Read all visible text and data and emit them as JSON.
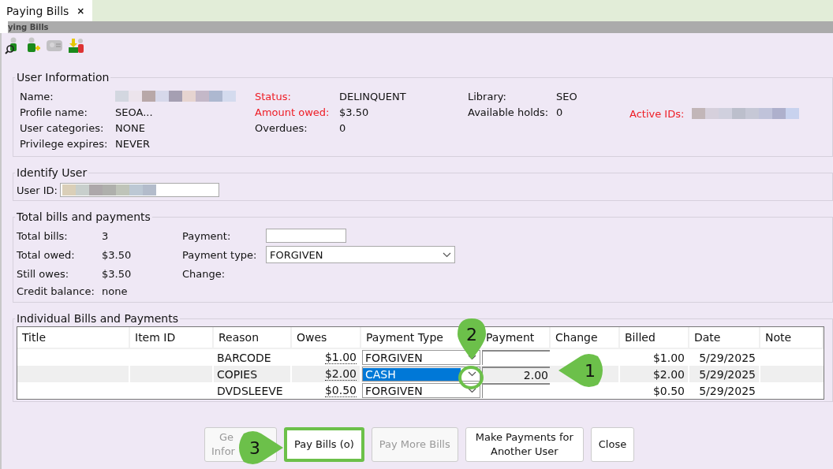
{
  "tab": {
    "label": "Paying Bills",
    "close": "×",
    "selected": true
  },
  "panel_title": "ying Bills",
  "toolbar": [
    {
      "kind": "search-user",
      "disabled": false
    },
    {
      "kind": "add-user",
      "disabled": false
    },
    {
      "kind": "card",
      "disabled": true
    },
    {
      "kind": "pay",
      "disabled": false
    }
  ],
  "user_information": {
    "title": "User Information",
    "columns": [
      [
        {
          "label": "Name:",
          "kind": "redacted",
          "alert": false
        },
        {
          "label": "Profile name:",
          "value": "SEOA...",
          "alert": false
        },
        {
          "label": "User categories:",
          "value": "NONE",
          "alert": false
        },
        {
          "label": "Privilege expires:",
          "value": "NEVER",
          "alert": false
        }
      ],
      [
        {
          "label": "Status:",
          "value": "DELINQUENT",
          "alert": true
        },
        {
          "label": "Amount owed:",
          "value": "$3.50",
          "alert": true
        },
        {
          "label": "Overdues:",
          "value": "0",
          "alert": false
        }
      ],
      [
        {
          "label": "Library:",
          "value": "SEO",
          "alert": false
        },
        {
          "label": "Available holds:",
          "value": "0",
          "alert": false
        }
      ]
    ],
    "active_ids": {
      "label": "Active IDs:",
      "kind": "redacted",
      "alert": true
    }
  },
  "identify_user": {
    "title": "Identify User",
    "label": "User ID:",
    "kind": "redacted"
  },
  "totals": {
    "title": "Total bills and payments",
    "rows": [
      {
        "label": "Total bills:",
        "value": "3"
      },
      {
        "label": "Total owed:",
        "value": "$3.50"
      },
      {
        "label": "Still owes:",
        "value": "$3.50"
      },
      {
        "label": "Credit balance:",
        "value": "none"
      }
    ],
    "payment_label": "Payment:",
    "payment_type_label": "Payment type:",
    "payment_type": "FORGIVEN",
    "change_label": "Change:"
  },
  "bills": {
    "title": "Individual Bills and Payments",
    "columns": [
      "Title",
      "Item ID",
      "Reason",
      "Owes",
      "Payment Type",
      "Payment",
      "Change",
      "Billed",
      "Date",
      "Note"
    ],
    "rows": [
      {
        "reason": "BARCODE",
        "owes": "$1.00",
        "payment_type": "FORGIVEN",
        "payment": "",
        "billed": "$1.00",
        "date": "5/29/2025",
        "selected": false
      },
      {
        "reason": "COPIES",
        "owes": "$2.00",
        "payment_type": "CASH",
        "payment": "2.00",
        "billed": "$2.00",
        "date": "5/29/2025",
        "selected": true
      },
      {
        "reason": "DVDSLEEVE",
        "owes": "$0.50",
        "payment_type": "FORGIVEN",
        "payment": "",
        "billed": "$0.50",
        "date": "5/29/2025",
        "selected": false
      }
    ]
  },
  "buttons": [
    {
      "lines": [
        "Ge",
        "Infor"
      ],
      "disabled": true,
      "highlighted": false
    },
    {
      "label": "Pay Bills (o)",
      "disabled": false,
      "highlighted": true
    },
    {
      "label": "Pay More Bills",
      "disabled": true,
      "highlighted": false
    },
    {
      "label": "Make Payments for Another User",
      "disabled": false,
      "highlighted": false
    },
    {
      "label": "Close",
      "disabled": false,
      "highlighted": false
    }
  ],
  "callouts": [
    {
      "label": "1",
      "kind": "left"
    },
    {
      "label": "2",
      "kind": "down"
    },
    {
      "label": "3",
      "kind": "right"
    }
  ]
}
